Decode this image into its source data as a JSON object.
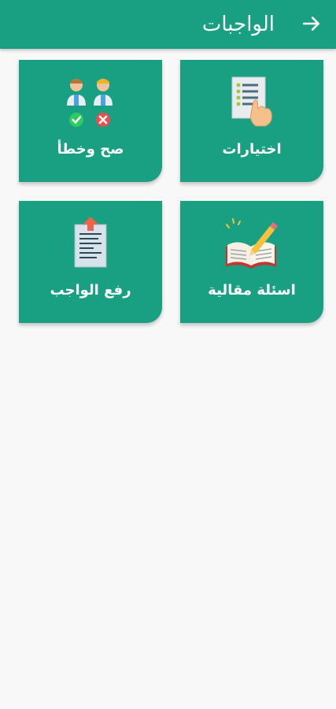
{
  "header": {
    "title": "الواجبات",
    "back_icon": "arrow-right-icon"
  },
  "cards": {
    "choices": {
      "label": "اختيارات",
      "icon": "checklist-hand-icon"
    },
    "true_false": {
      "label": "صح وخطأ",
      "icon": "true-false-people-icon"
    },
    "essay": {
      "label": "اسئلة مقالية",
      "icon": "book-pencil-icon"
    },
    "upload": {
      "label": "رفع الواجب",
      "icon": "upload-document-icon"
    }
  },
  "colors": {
    "primary": "#19a083",
    "background": "#f8f8f9"
  }
}
